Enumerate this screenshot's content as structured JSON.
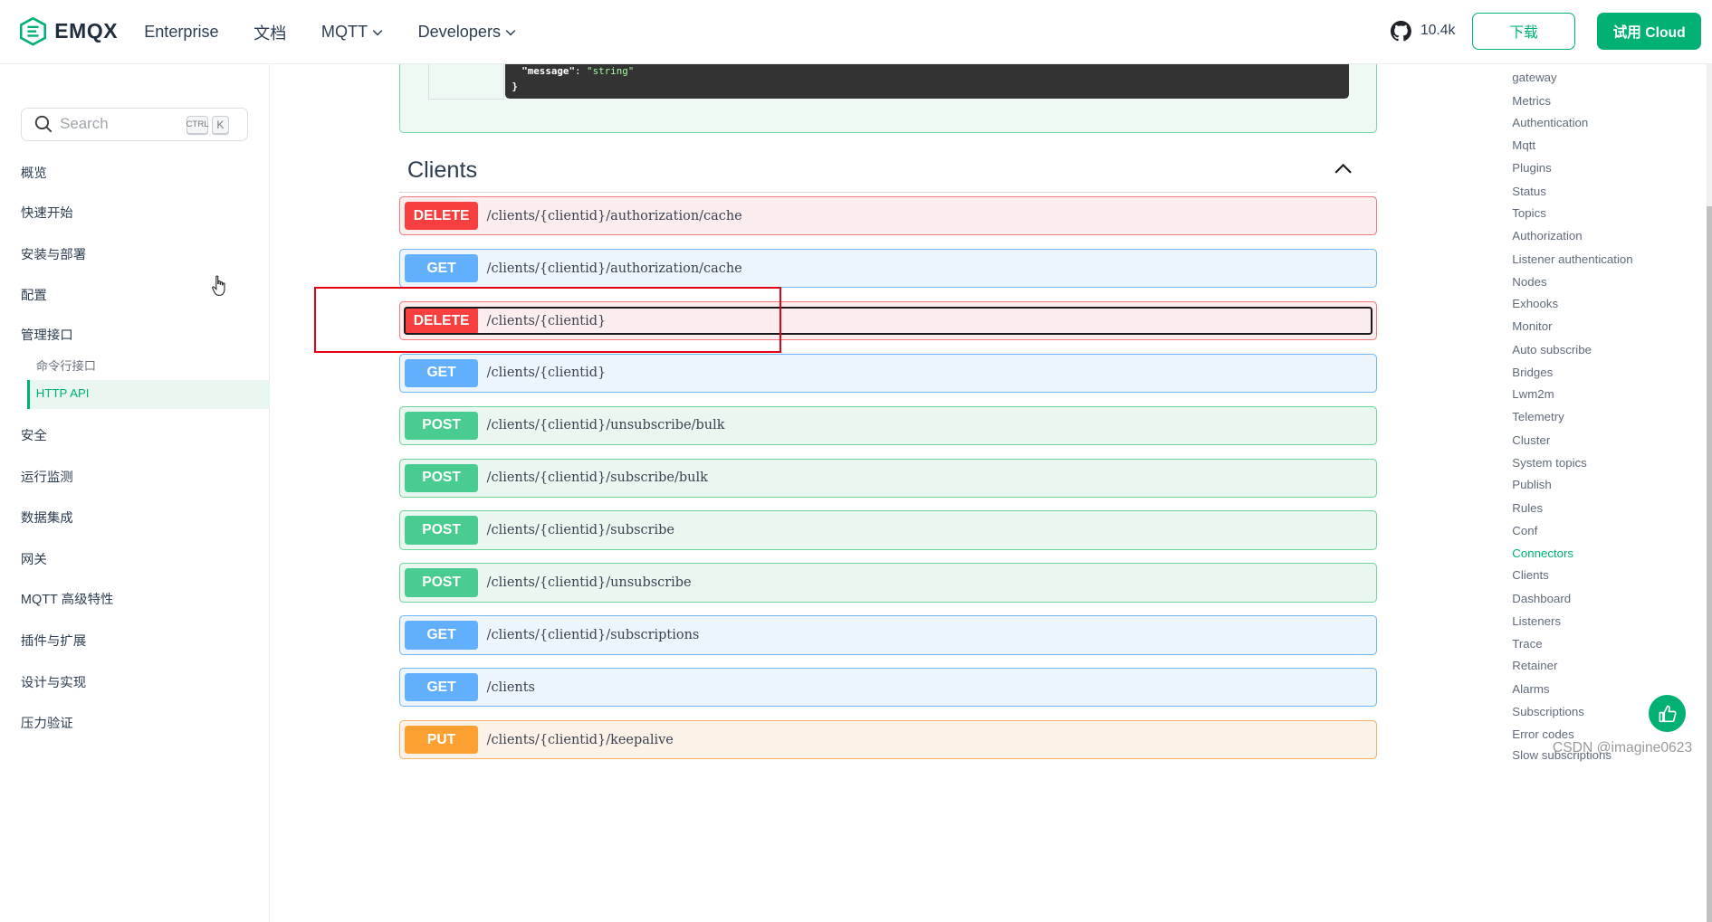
{
  "header": {
    "logo_text": "EMQX",
    "nav": [
      {
        "label": "Enterprise",
        "has_dropdown": false
      },
      {
        "label": "文档",
        "has_dropdown": false
      },
      {
        "label": "MQTT",
        "has_dropdown": true
      },
      {
        "label": "Developers",
        "has_dropdown": true
      }
    ],
    "github_stars": "10.4k",
    "download_label": "下载",
    "cloud_label": "试用 Cloud"
  },
  "sidebar": {
    "search_placeholder": "Search",
    "shortcut_ctrl": "CTRL",
    "shortcut_key": "K",
    "items": [
      "概览",
      "快速开始",
      "安装与部署",
      "配置",
      "管理接口",
      "安全",
      "运行监测",
      "数据集成",
      "网关",
      "MQTT 高级特性",
      "插件与扩展",
      "设计与实现",
      "压力验证"
    ],
    "subitems": [
      "命令行接口",
      "HTTP API"
    ],
    "active_subitem": "HTTP API"
  },
  "main": {
    "code_lines": [
      {
        "key": "\"message\"",
        "sep": ": ",
        "value": "\"string\""
      },
      {
        "key": "}",
        "sep": "",
        "value": ""
      }
    ],
    "section_title": "Clients",
    "operations": [
      {
        "method": "DELETE",
        "path": "/clients/{clientid}/authorization/cache"
      },
      {
        "method": "GET",
        "path": "/clients/{clientid}/authorization/cache"
      },
      {
        "method": "DELETE",
        "path": "/clients/{clientid}"
      },
      {
        "method": "GET",
        "path": "/clients/{clientid}"
      },
      {
        "method": "POST",
        "path": "/clients/{clientid}/unsubscribe/bulk"
      },
      {
        "method": "POST",
        "path": "/clients/{clientid}/subscribe/bulk"
      },
      {
        "method": "POST",
        "path": "/clients/{clientid}/subscribe"
      },
      {
        "method": "POST",
        "path": "/clients/{clientid}/unsubscribe"
      },
      {
        "method": "GET",
        "path": "/clients/{clientid}/subscriptions"
      },
      {
        "method": "GET",
        "path": "/clients"
      },
      {
        "method": "PUT",
        "path": "/clients/{clientid}/keepalive"
      }
    ]
  },
  "toc": {
    "items": [
      "gateway",
      "Metrics",
      "Authentication",
      "Mqtt",
      "Plugins",
      "Status",
      "Topics",
      "Authorization",
      "Listener authentication",
      "Nodes",
      "Exhooks",
      "Monitor",
      "Auto subscribe",
      "Bridges",
      "Lwm2m",
      "Telemetry",
      "Cluster",
      "System topics",
      "Publish",
      "Rules",
      "Conf",
      "Connectors",
      "Clients",
      "Dashboard",
      "Listeners",
      "Trace",
      "Retainer",
      "Alarms",
      "Subscriptions",
      "Error codes",
      "Slow subscriptions"
    ],
    "active_item": "Connectors"
  },
  "watermark": "CSDN @imagine0623",
  "colors": {
    "brand": "#00b173",
    "delete": "#f83f3f",
    "get": "#62affe",
    "post": "#48cc90",
    "put": "#fda032",
    "annotation_box": "#e60012"
  }
}
